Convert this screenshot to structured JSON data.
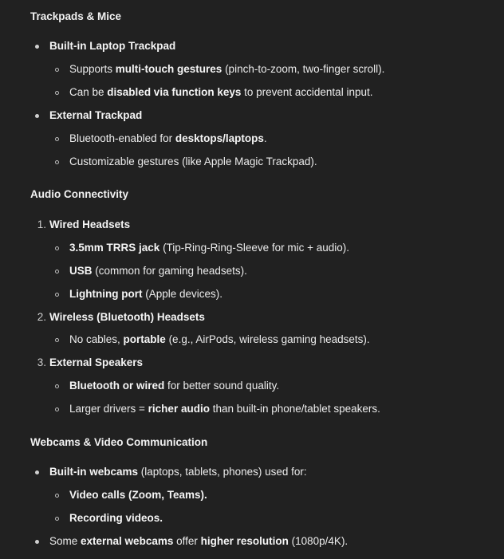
{
  "sections": {
    "trackpads": {
      "title": "Trackpads & Mice",
      "item1": {
        "label": "Built-in Laptop Trackpad",
        "sub1": {
          "pre": "Supports ",
          "bold": "multi-touch gestures",
          "post": " (pinch-to-zoom, two-finger scroll)."
        },
        "sub2": {
          "pre": "Can be ",
          "bold": "disabled via function keys",
          "post": " to prevent accidental input."
        }
      },
      "item2": {
        "label": "External Trackpad",
        "sub1": {
          "pre": "Bluetooth-enabled for ",
          "bold": "desktops/laptops",
          "post": "."
        },
        "sub2": {
          "text": "Customizable gestures (like Apple Magic Trackpad)."
        }
      }
    },
    "audio": {
      "title": "Audio Connectivity",
      "item1": {
        "num": "1.",
        "label": "Wired Headsets",
        "sub1": {
          "bold": "3.5mm TRRS jack",
          "post": " (Tip-Ring-Ring-Sleeve for mic + audio)."
        },
        "sub2": {
          "bold": "USB",
          "post": " (common for gaming headsets)."
        },
        "sub3": {
          "bold": "Lightning port",
          "post": " (Apple devices)."
        }
      },
      "item2": {
        "num": "2.",
        "label": "Wireless (Bluetooth) Headsets",
        "sub1": {
          "pre": "No cables, ",
          "bold": "portable",
          "post": " (e.g., AirPods, wireless gaming headsets)."
        }
      },
      "item3": {
        "num": "3.",
        "label": "External Speakers",
        "sub1": {
          "bold": "Bluetooth or wired",
          "post": " for better sound quality."
        },
        "sub2": {
          "pre": "Larger drivers = ",
          "bold": "richer audio",
          "post": " than built-in phone/tablet speakers."
        }
      }
    },
    "webcams": {
      "title": "Webcams & Video Communication",
      "item1": {
        "bold": "Built-in webcams",
        "post": " (laptops, tablets, phones) used for:",
        "sub1": {
          "bold": "Video calls (Zoom, Teams)."
        },
        "sub2": {
          "bold": "Recording videos."
        }
      },
      "item2": {
        "pre": "Some ",
        "bold1": "external webcams",
        "mid": " offer ",
        "bold2": "higher resolution",
        "post": " (1080p/4K)."
      }
    }
  }
}
